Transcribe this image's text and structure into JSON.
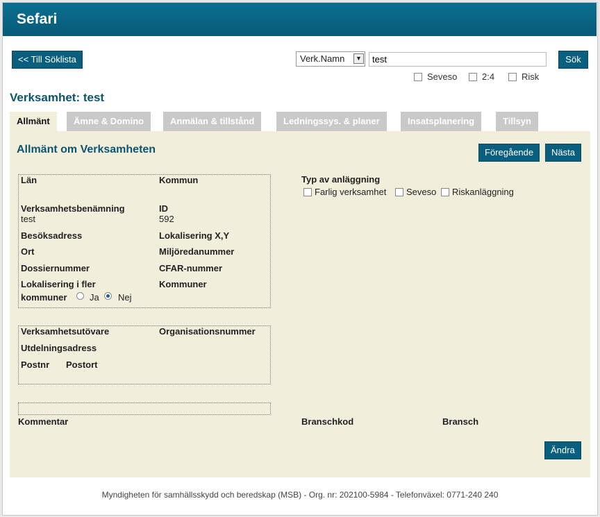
{
  "app": {
    "title": "Sefari"
  },
  "toolbar": {
    "back_label": "<< Till Söklista",
    "search_field_select": "Verk.Namn",
    "search_value": "test",
    "search_button": "Sök",
    "filters": [
      "Seveso",
      "2:4",
      "Risk"
    ]
  },
  "page": {
    "title": "Verksamhet: test"
  },
  "tabs": [
    "Allmänt",
    "Ämne & Domino",
    "Anmälan & tillstånd",
    "Ledningssys. & planer",
    "Insatsplanering",
    "Tillsyn"
  ],
  "section": {
    "title": "Allmänt om Verksamheten",
    "prev_label": "Föregående",
    "next_label": "Nästa"
  },
  "box1": {
    "lan": "Län",
    "kommun": "Kommun",
    "verksamhetsbenamning": "Verksamhetsbenämning",
    "verksamhetsbenamning_value": "test",
    "id": "ID",
    "id_value": "592",
    "besoksadress": "Besöksadress",
    "lokalisering": "Lokalisering X,Y",
    "ort": "Ort",
    "miljoredanummer": "Miljöredanummer",
    "dossiernummer": "Dossiernummer",
    "cfar": "CFAR-nummer",
    "lok_fler_1": "Lokalisering i fler",
    "lok_fler_2": "kommuner",
    "ja": "Ja",
    "nej": "Nej",
    "kommuner": "Kommuner"
  },
  "box2": {
    "verksamhetsutovare": "Verksamhetsutövare",
    "organisationsnummer": "Organisationsnummer",
    "utdelningsadress": "Utdelningsadress",
    "postnr": "Postnr",
    "postort": "Postort"
  },
  "typ": {
    "title": "Typ av anläggning",
    "options": [
      "Farlig verksamhet",
      "Seveso",
      "Riskanläggning"
    ]
  },
  "bottom": {
    "kommentar": "Kommentar",
    "branschkod": "Branschkod",
    "bransch": "Bransch",
    "andra_label": "Ändra"
  },
  "footer": {
    "text": "Myndigheten för samhällsskydd och beredskap (MSB) - Org. nr: 202100-5984 - Telefonväxel: 0771-240 240"
  }
}
